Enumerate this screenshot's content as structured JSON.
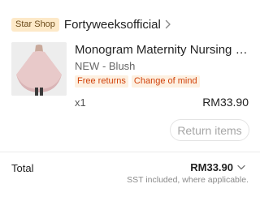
{
  "shop": {
    "badge": "Star Shop",
    "name": "Fortyweeksofficial",
    "chevron_icon": "chevron-right-icon"
  },
  "item": {
    "title": "Monogram Maternity Nursing Cover - Blush",
    "variant": "NEW - Blush",
    "tags": [
      "Free returns",
      "Change of mind"
    ],
    "quantity": "x1",
    "price": "RM33.90",
    "return_button": "Return items"
  },
  "summary": {
    "total_label": "Total",
    "total_value": "RM33.90",
    "chevron_icon": "chevron-down-icon",
    "note": "SST included, where applicable."
  },
  "colors": {
    "badge_bg": "#fde9c8",
    "tag_bg": "#fdf0e1",
    "tag_text": "#d1420a"
  }
}
